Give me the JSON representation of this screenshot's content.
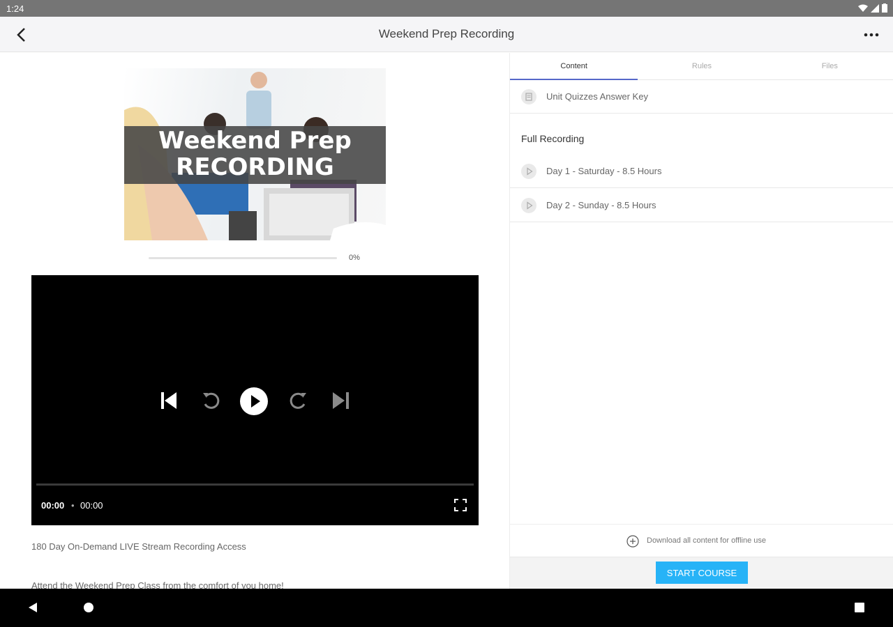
{
  "status_bar": {
    "time": "1:24"
  },
  "app_bar": {
    "title": "Weekend Prep Recording"
  },
  "banner": {
    "line1": "Weekend Prep",
    "line2": "RECORDING"
  },
  "progress": {
    "value": 0,
    "label": "0%"
  },
  "player": {
    "current_time": "00:00",
    "separator": "•",
    "duration": "00:00"
  },
  "description": {
    "line1": "180 Day On-Demand LIVE Stream Recording Access",
    "line2": "Attend the Weekend Prep Class from the comfort of you home!"
  },
  "tabs": [
    {
      "label": "Content",
      "active": true
    },
    {
      "label": "Rules",
      "active": false
    },
    {
      "label": "Files",
      "active": false
    }
  ],
  "content": {
    "items_top": [
      {
        "label": "Unit Quizzes Answer Key",
        "icon": "document-icon"
      }
    ],
    "section_title": "Full Recording",
    "section_items": [
      {
        "label": "Day 1 - Saturday - 8.5 Hours",
        "icon": "play-icon"
      },
      {
        "label": "Day 2 - Sunday - 8.5 Hours",
        "icon": "play-icon"
      }
    ]
  },
  "footer": {
    "download_label": "Download all content for offline use",
    "start_label": "START COURSE"
  },
  "colors": {
    "accent": "#27b3f7",
    "tab_indicator": "#5567c9",
    "progress": "#3d8bfd"
  }
}
